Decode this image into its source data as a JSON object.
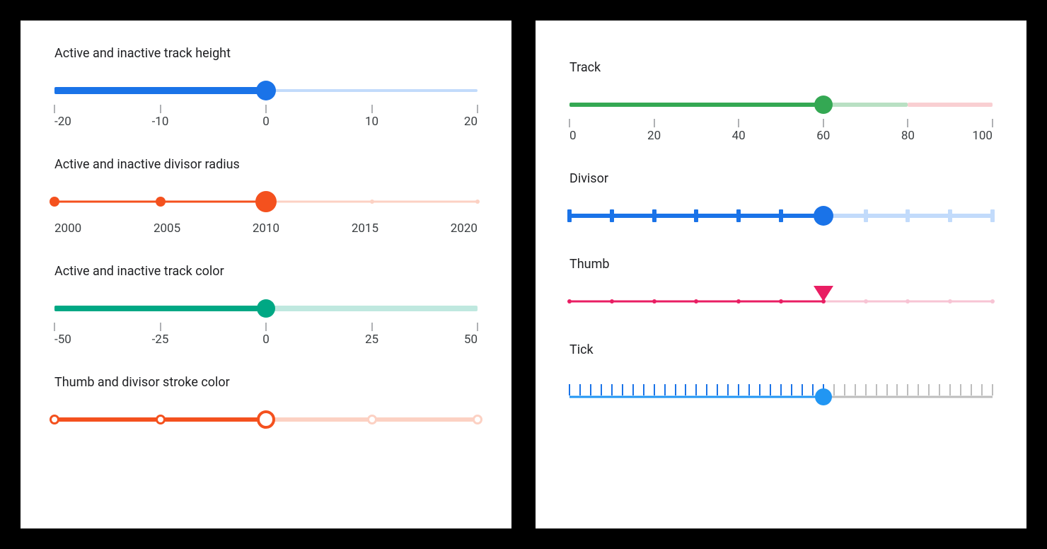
{
  "left": {
    "s1": {
      "title": "Active and inactive track height",
      "scale": [
        "-20",
        "-10",
        "0",
        "10",
        "20"
      ],
      "value_pct": 50,
      "colors": {
        "active": "#1a73e8",
        "inactive": "#c2dbfb"
      },
      "track": {
        "active_h": 10,
        "inactive_h": 4
      },
      "thumb_d": 28
    },
    "s2": {
      "title": "Active and inactive divisor radius",
      "scale": [
        "2000",
        "2005",
        "2010",
        "2015",
        "2020"
      ],
      "value_pct": 50,
      "colors": {
        "active": "#f4511e",
        "inactive": "#fcd1c3"
      },
      "track_h": 3,
      "divisor_active_d": 14,
      "divisor_inactive_d": 6,
      "thumb_d": 30
    },
    "s3": {
      "title": "Active and inactive track color",
      "scale": [
        "-50",
        "-25",
        "0",
        "25",
        "50"
      ],
      "value_pct": 50,
      "colors": {
        "active": "#00a884",
        "inactive": "#bfe8df"
      },
      "track_h": 8,
      "thumb_d": 26
    },
    "s4": {
      "title": "Thumb and divisor stroke color",
      "value_pct": 50,
      "colors": {
        "active": "#f4511e",
        "inactive": "#fcd1c3"
      },
      "track_h": 6,
      "divisor_d": 14,
      "thumb_d": 26,
      "stops": 5
    }
  },
  "right": {
    "scale": [
      "0",
      "20",
      "40",
      "60",
      "80",
      "100"
    ],
    "s1": {
      "title": "Track",
      "value_pct": 60,
      "segments": [
        {
          "from": 0,
          "to": 60,
          "color": "#34a853",
          "h": 6
        },
        {
          "from": 60,
          "to": 80,
          "color": "#b9e0c3",
          "h": 6
        },
        {
          "from": 80,
          "to": 100,
          "color": "#f9cfd2",
          "h": 6
        }
      ],
      "thumb_d": 26,
      "thumb_color": "#34a853"
    },
    "s2": {
      "title": "Divisor",
      "value_pct": 60,
      "colors": {
        "active": "#1a73e8",
        "inactive": "#c2dbfb"
      },
      "track_h": 6,
      "tick_h": 18,
      "tick_w": 6,
      "stops": 11,
      "thumb_d": 28
    },
    "s3": {
      "title": "Thumb",
      "value_pct": 60,
      "colors": {
        "active": "#e91e63",
        "inactive": "#f7c4d4"
      },
      "track_h": 3,
      "divisor_d": 6,
      "stops": 11,
      "thumb_w": 28,
      "thumb_h": 22
    },
    "s4": {
      "title": "Tick",
      "value_pct": 60,
      "colors": {
        "active": "#2196f3",
        "inactive": "#bdbdbd",
        "tick_active": "#1a73e8",
        "tick_inactive": "#bdbdbd"
      },
      "track_h": 3,
      "tick_h": 16,
      "ticks": 41,
      "thumb_d": 24
    }
  }
}
